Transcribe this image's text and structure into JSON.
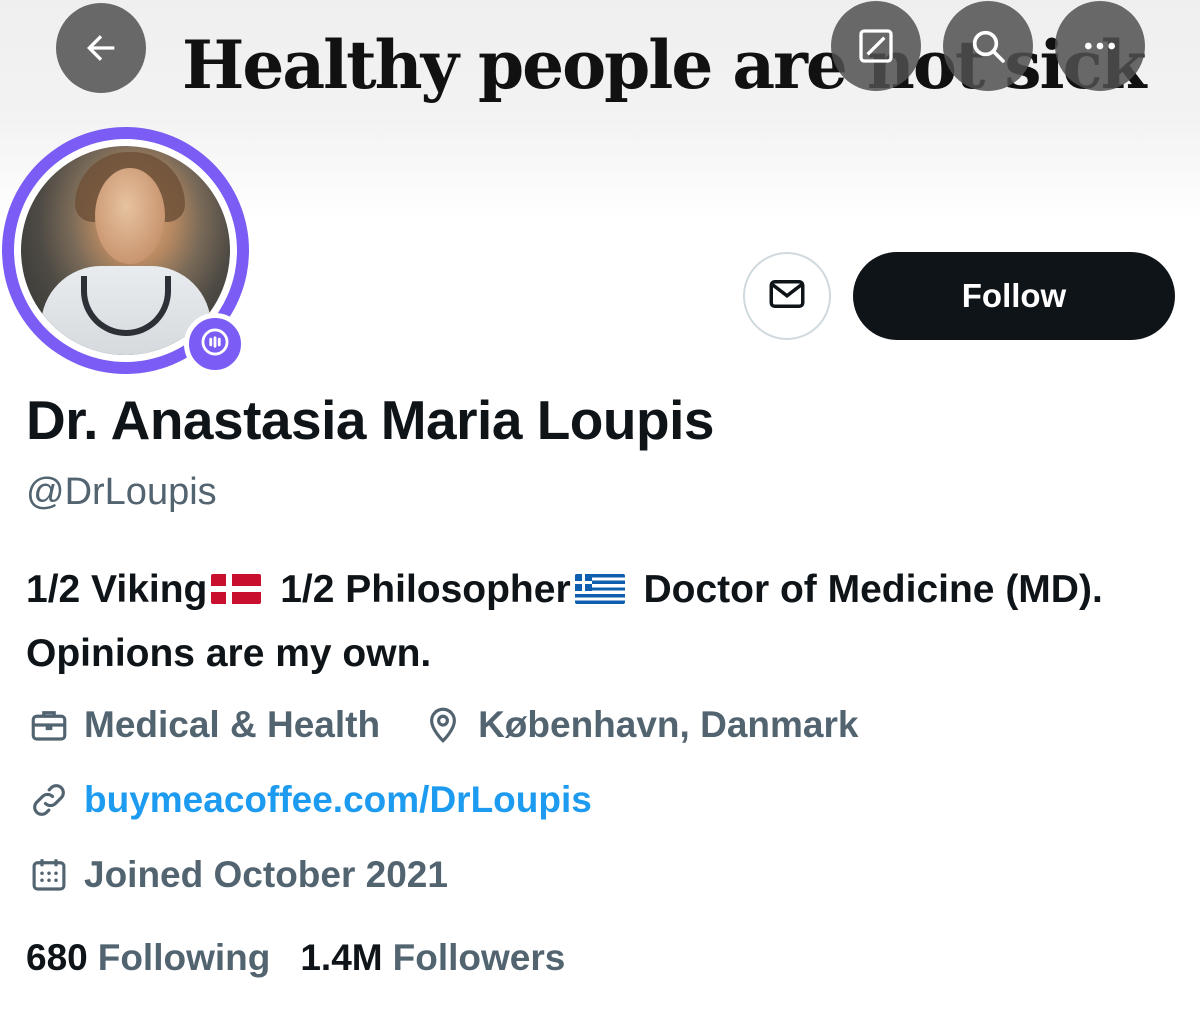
{
  "banner": {
    "text": "Healthy people are not sick"
  },
  "profile": {
    "name": "Dr. Anastasia Maria Loupis",
    "handle": "@DrLoupis",
    "bio": {
      "part1": "1/2 Viking",
      "part2": "1/2 Philosopher",
      "part3": "Doctor of Medicine (MD). Opinions are my own."
    },
    "category": "Medical & Health",
    "location": "København, Danmark",
    "website": "buymeacoffee.com/DrLoupis",
    "joined": "Joined October 2021",
    "following_count": "680",
    "following_label": "Following",
    "followers_count": "1.4M",
    "followers_label": "Followers"
  },
  "actions": {
    "follow_label": "Follow"
  },
  "icons": {
    "back": "arrow-left-icon",
    "grok": "grok-icon",
    "search": "search-icon",
    "more": "more-icon",
    "message": "envelope-icon",
    "space": "spaces-icon",
    "category": "briefcase-icon",
    "location": "location-pin-icon",
    "link": "link-icon",
    "calendar": "calendar-icon",
    "flag_dk": "denmark-flag-icon",
    "flag_gr": "greece-flag-icon"
  },
  "colors": {
    "accent_purple": "#7b5cf5",
    "link_blue": "#1d9bf0",
    "secondary_text": "#536471",
    "primary_text": "#0f1419"
  }
}
